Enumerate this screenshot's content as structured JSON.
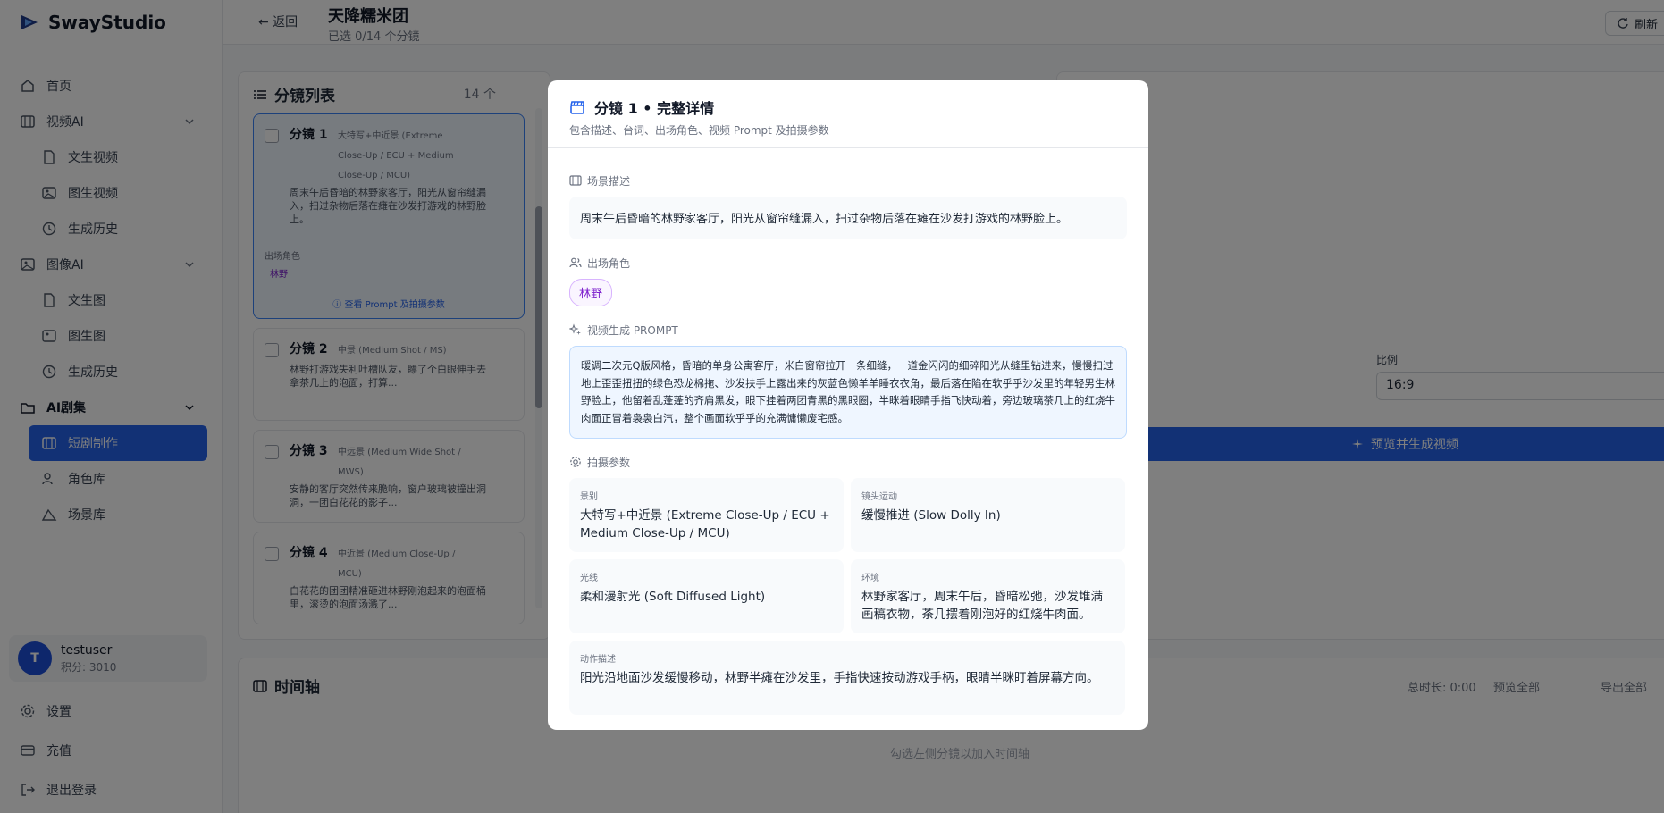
{
  "app": {
    "name": "SwayStudio"
  },
  "sidebar": {
    "items": [
      {
        "label": "首页"
      },
      {
        "label": "视频AI"
      },
      {
        "label": "文生视频"
      },
      {
        "label": "图生视频"
      },
      {
        "label": "生成历史"
      },
      {
        "label": "图像AI"
      },
      {
        "label": "文生图"
      },
      {
        "label": "图生图"
      },
      {
        "label": "生成历史"
      },
      {
        "label": "AI剧集"
      },
      {
        "label": "短剧制作"
      },
      {
        "label": "角色库"
      },
      {
        "label": "场景库"
      }
    ],
    "user": {
      "initial": "T",
      "name": "testuser",
      "points": "积分: 3010"
    },
    "bottom": [
      {
        "label": "设置"
      },
      {
        "label": "充值"
      },
      {
        "label": "退出登录"
      }
    ]
  },
  "header": {
    "back": "← 返回",
    "title": "天降糯米团",
    "subtitle": "已选 0/14 个分镜",
    "refresh": "刷新"
  },
  "shot_list": {
    "title": "分镜列表",
    "count": "14 个",
    "shots": [
      {
        "name": "分镜 1",
        "type": "大特写+中近景 (Extreme Close-Up / ECU + Medium Close-Up / MCU)",
        "desc": "周末午后昏暗的林野家客厅，阳光从窗帘缝漏入，扫过杂物后落在瘫在沙发打游戏的林野脸上。",
        "chars_label": "出场角色",
        "char": "林野",
        "link": "ⓘ 查看 Prompt 及拍摄参数"
      },
      {
        "name": "分镜 2",
        "type": "中景 (Medium Shot / MS)",
        "desc": "林野打游戏失利吐槽队友，瞟了个白眼伸手去拿茶几上的泡面，打算..."
      },
      {
        "name": "分镜 3",
        "type": "中远景 (Medium Wide Shot / MWS)",
        "desc": "安静的客厅突然传来脆响，窗户玻璃被撞出洞洞，一团白花花的影子..."
      },
      {
        "name": "分镜 4",
        "type": "中近景 (Medium Close-Up / MCU)",
        "desc": "白花花的团团精准砸进林野刚泡起来的泡面桶里，滚烫的泡面汤溅了..."
      }
    ]
  },
  "right_panel": {
    "ratio_label": "比例",
    "ratio_value": "16:9",
    "generate": "预览并生成视频"
  },
  "timeline": {
    "title": "时间轴",
    "duration": "总时长: 0:00",
    "preview_all": "预览全部",
    "export_all": "导出全部",
    "empty": "勾选左侧分镜以加入时间轴"
  },
  "modal": {
    "title": "分镜 1 • 完整详情",
    "subtitle": "包含描述、台词、出场角色、视频 Prompt 及拍摄参数",
    "scene_label": "场景描述",
    "scene_text": "周末午后昏暗的林野家客厅，阳光从窗帘缝漏入，扫过杂物后落在瘫在沙发打游戏的林野脸上。",
    "chars_label": "出场角色",
    "char": "林野",
    "prompt_label": "视频生成 PROMPT",
    "prompt_text": "暖调二次元Q版风格，昏暗的单身公寓客厅，米白窗帘拉开一条细缝，一道金闪闪的细碎阳光从缝里钻进来，慢慢扫过地上歪歪扭扭的绿色恐龙棉拖、沙发扶手上露出来的灰蓝色懒羊羊睡衣衣角，最后落在陷在软乎乎沙发里的年轻男生林野脸上，他留着乱蓬蓬的齐肩黑发，眼下挂着两团青黑的黑眼圈，半眯着眼睛手指飞快动着，旁边玻璃茶几上的红烧牛肉面正冒着袅袅白汽，整个画面软乎乎的充满慵懒废宅感。",
    "params_label": "拍摄参数",
    "params": [
      {
        "label": "景别",
        "value": "大特写+中近景 (Extreme Close-Up / ECU + Medium Close-Up / MCU)"
      },
      {
        "label": "镜头运动",
        "value": "缓慢推进 (Slow Dolly In)"
      },
      {
        "label": "光线",
        "value": "柔和漫射光 (Soft Diffused Light)"
      },
      {
        "label": "环境",
        "value": "林野家客厅，周末午后，昏暗松弛，沙发堆满画稿衣物，茶几摆着刚泡好的红烧牛肉面。"
      },
      {
        "label": "动作描述",
        "value": "阳光沿地面沙发缓慢移动，林野半瘫在沙发里，手指快速按动游戏手柄，眼睛半眯盯着屏幕方向。"
      }
    ]
  }
}
